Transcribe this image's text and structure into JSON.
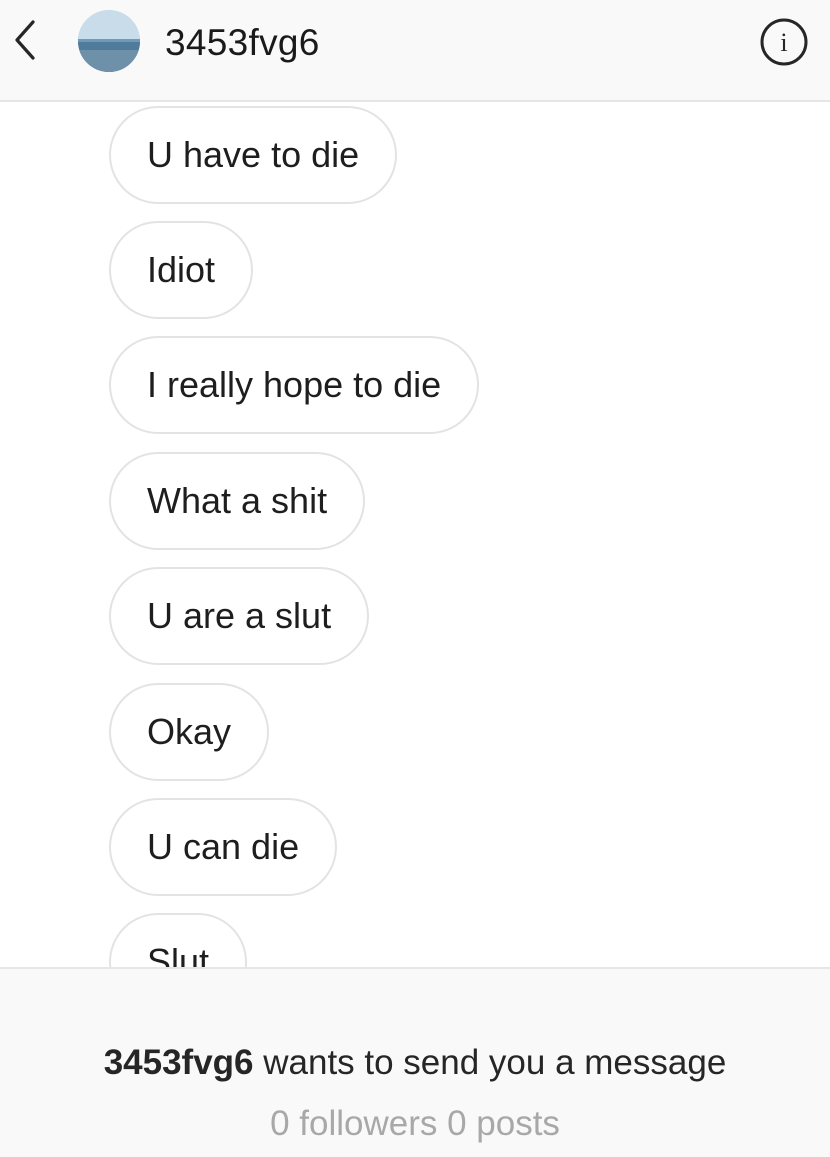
{
  "header": {
    "username": "3453fvg6",
    "back_icon": "chevron-left-icon",
    "info_icon": "info-icon",
    "info_glyph": "i"
  },
  "messages": [
    {
      "text": "U have to die"
    },
    {
      "text": "Idiot"
    },
    {
      "text": "I really hope to die"
    },
    {
      "text": "What a shit"
    },
    {
      "text": "U are a slut"
    },
    {
      "text": "Okay"
    },
    {
      "text": "U can die"
    },
    {
      "text": "Slut"
    }
  ],
  "request": {
    "username": "3453fvg6",
    "message": " wants to send you a message",
    "stats": "0 followers 0 posts"
  },
  "colors": {
    "header_bg": "#f9f9f9",
    "bubble_border": "#e3e3e3",
    "muted_text": "#a8a8a8"
  }
}
